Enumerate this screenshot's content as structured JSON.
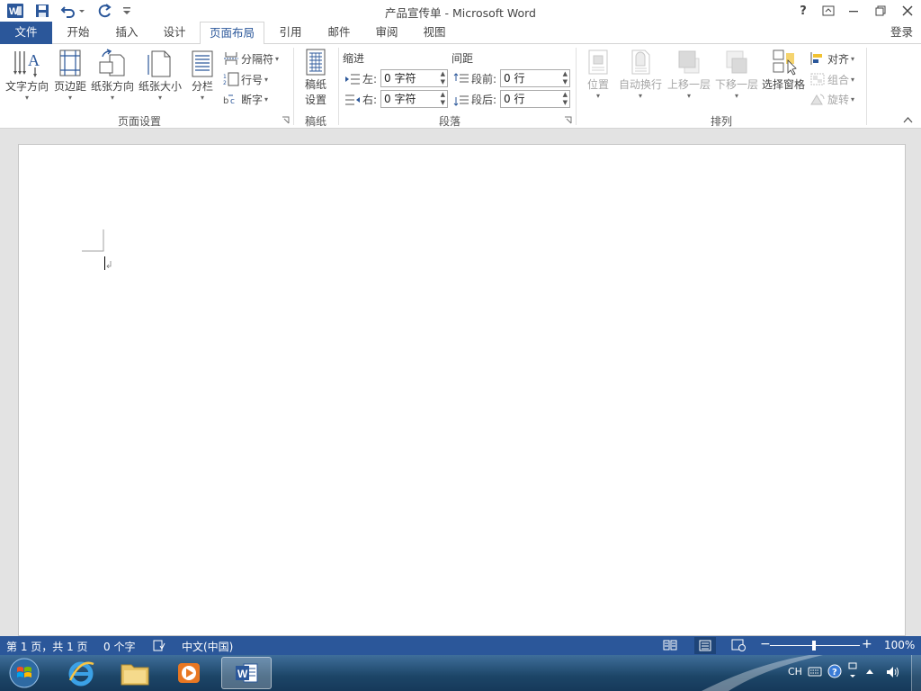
{
  "app": {
    "window_title": "产品宣传单 - Microsoft Word",
    "help_label": "?",
    "sign_in": "登录"
  },
  "tabs": [
    "文件",
    "开始",
    "插入",
    "设计",
    "页面布局",
    "引用",
    "邮件",
    "审阅",
    "视图"
  ],
  "active_tab": "页面布局",
  "ribbon": {
    "page_setup": {
      "group_label": "页面设置",
      "text_direction": "文字方向",
      "margins": "页边距",
      "orientation": "纸张方向",
      "size": "纸张大小",
      "columns": "分栏",
      "breaks": "分隔符",
      "line_numbers": "行号",
      "hyphenation": "断字"
    },
    "manuscript": {
      "group_label": "稿纸",
      "button_line1": "稿纸",
      "button_line2": "设置"
    },
    "paragraph": {
      "group_label": "段落",
      "indent_header": "缩进",
      "spacing_header": "间距",
      "left_label": "左:",
      "left_value": "0 字符",
      "right_label": "右:",
      "right_value": "0 字符",
      "before_label": "段前:",
      "before_value": "0 行",
      "after_label": "段后:",
      "after_value": "0 行"
    },
    "arrange": {
      "group_label": "排列",
      "position": "位置",
      "wrap_text": "自动换行",
      "bring_forward": "上移一层",
      "send_backward": "下移一层",
      "selection_pane": "选择窗格",
      "align": "对齐",
      "group": "组合",
      "rotate": "旋转"
    }
  },
  "status": {
    "page": "第 1 页，共 1 页",
    "words": "0 个字",
    "language": "中文(中国)",
    "zoom": "100%"
  },
  "taskbar": {
    "lang": "CH"
  },
  "colors": {
    "accent": "#2b579a",
    "taskbar": "#1c4567"
  }
}
